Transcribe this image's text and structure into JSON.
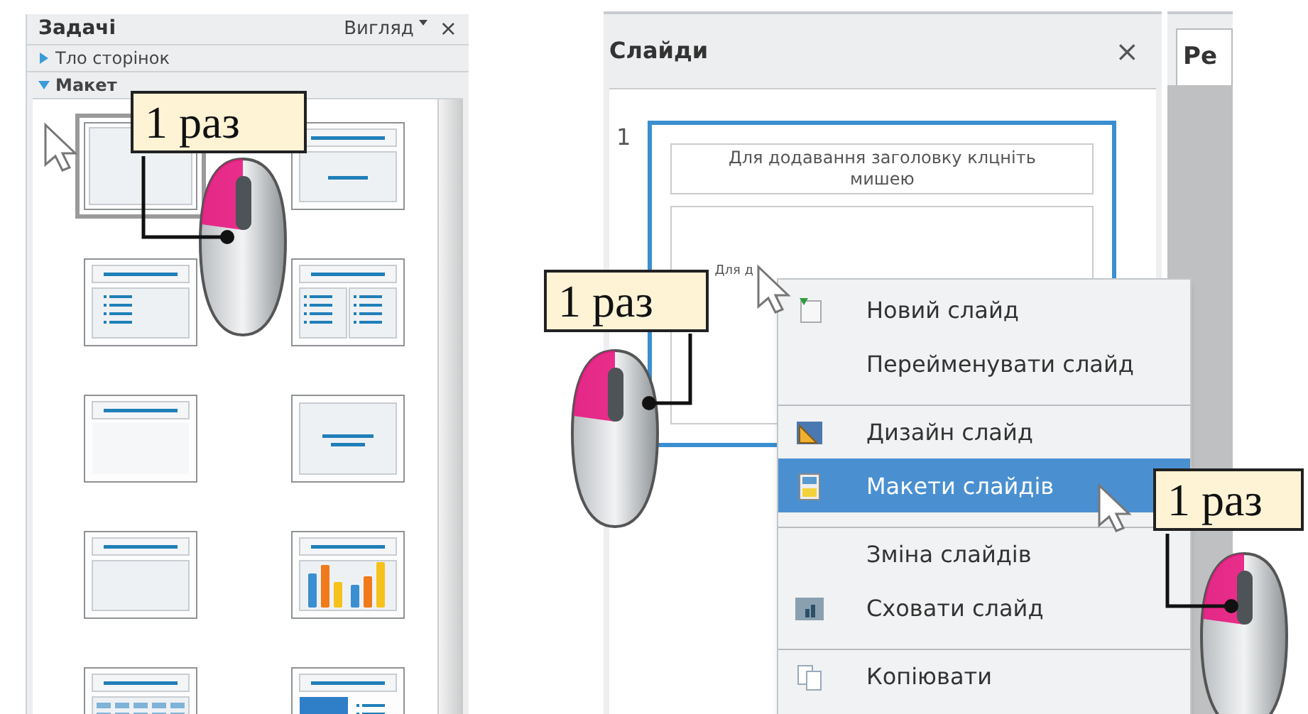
{
  "tasks_panel": {
    "title": "Задачі",
    "view_menu": "Вигляд",
    "close": "×",
    "sections": [
      {
        "label": "Тло сторінок",
        "expanded": false
      },
      {
        "label": "Макет",
        "expanded": true
      }
    ],
    "layouts": [
      {
        "kind": "blank",
        "selected": true
      },
      {
        "kind": "title-content",
        "selected": false
      },
      {
        "kind": "title-list",
        "selected": false
      },
      {
        "kind": "title-two-lists",
        "selected": false
      },
      {
        "kind": "title-only",
        "selected": false
      },
      {
        "kind": "centered-text",
        "selected": false
      },
      {
        "kind": "title-box",
        "selected": false
      },
      {
        "kind": "title-chart",
        "selected": false
      },
      {
        "kind": "title-table",
        "selected": false
      },
      {
        "kind": "title-picture",
        "selected": false
      }
    ]
  },
  "slides_panel": {
    "title": "Слайди",
    "close": "×",
    "slide": {
      "number": "1",
      "title_placeholder": "Для додавання заголовку клцніть мишею",
      "body_text": "Для д",
      "selected": true
    }
  },
  "editor_tab": "Ре",
  "context_menu": [
    {
      "label": "Новий слайд",
      "kind": "new",
      "separator_before": false,
      "selected": false
    },
    {
      "label": "Перейменувати слайд",
      "kind": "none",
      "separator_before": false,
      "selected": false
    },
    {
      "label": "Дизайн слайд",
      "kind": "design",
      "separator_before": true,
      "selected": false
    },
    {
      "label": "Макети слайдів",
      "kind": "layout",
      "separator_before": false,
      "selected": true
    },
    {
      "label": "Зміна слайдів",
      "kind": "none",
      "separator_before": true,
      "selected": false
    },
    {
      "label": "Сховати слайд",
      "kind": "hide",
      "separator_before": false,
      "selected": false
    },
    {
      "label": "Копіювати",
      "kind": "copy",
      "separator_before": true,
      "selected": false
    }
  ],
  "callouts": [
    "1 раз",
    "1 раз",
    "1 раз"
  ]
}
